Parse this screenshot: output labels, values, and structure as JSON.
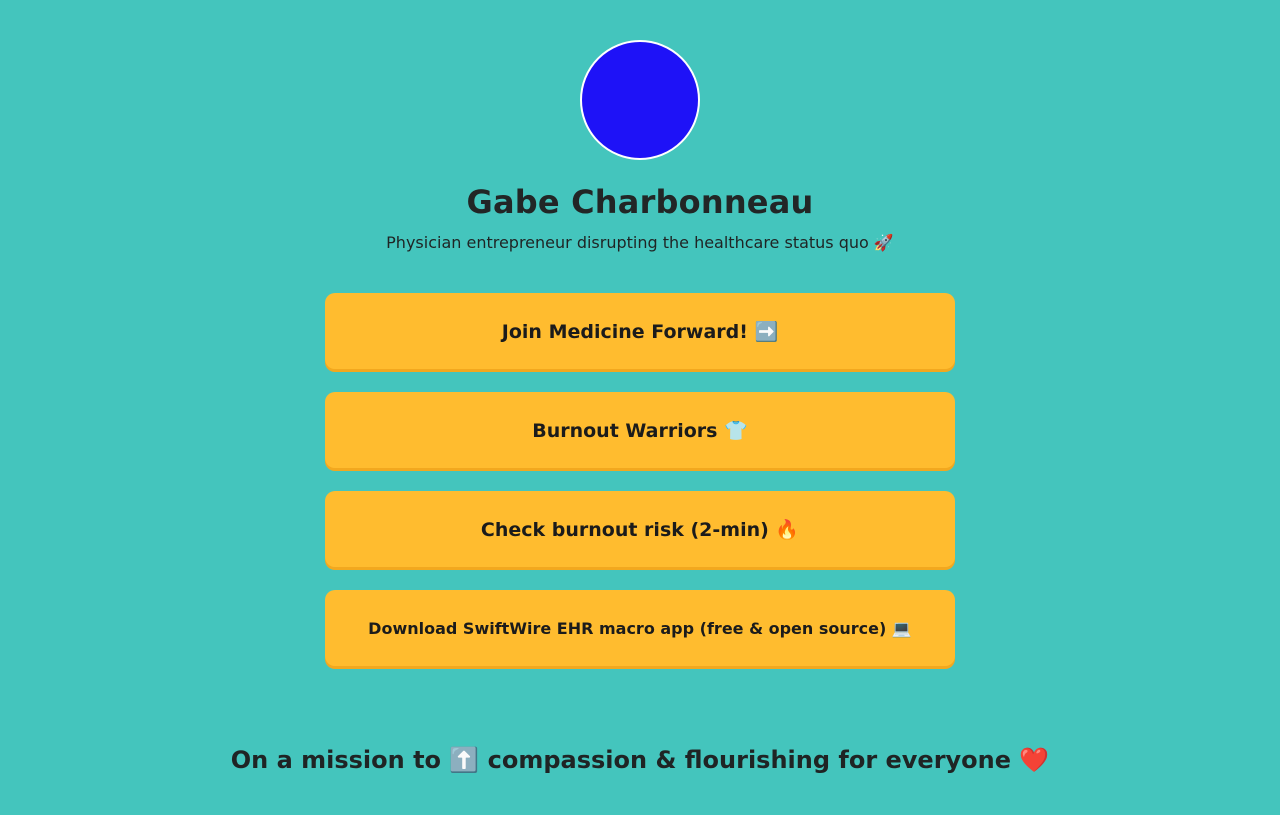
{
  "profile": {
    "avatar_color": "#1e12f7",
    "name": "Gabe Charbonneau",
    "bio": "Physician entrepreneur disrupting the healthcare status quo 🚀"
  },
  "links": [
    {
      "label": "Join Medicine Forward! ➡️"
    },
    {
      "label": "Burnout Warriors 👕"
    },
    {
      "label": "Check burnout risk (2-min) 🔥"
    },
    {
      "label": "Download SwiftWire EHR macro app (free & open source) 💻"
    }
  ],
  "footer": {
    "mission": "On a mission to ⬆️ compassion & flourishing for everyone ❤️"
  },
  "colors": {
    "background": "#44c5bd",
    "button": "#ffbc2f",
    "avatar": "#1e12f7"
  }
}
